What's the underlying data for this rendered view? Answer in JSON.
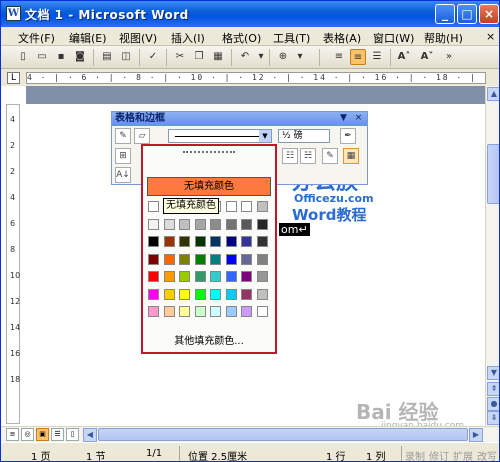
{
  "window": {
    "title": "文档 1 - Microsoft Word"
  },
  "menu": [
    "文件(F)",
    "编辑(E)",
    "视图(V)",
    "插入(I)",
    "格式(O)",
    "工具(T)",
    "表格(A)",
    "窗口(W)",
    "帮助(H)"
  ],
  "ruler": {
    "text": "4 · | · 6 · | · 8 · | · 10 · | · 12 · | · 14 · | · 16 · | · 18 · | · 20 · | · 22 · | · 24 · | · 26 · | · 28 · | · 30 · | · 32 · | · 34 · | · 36 · | · 38"
  },
  "vruler": [
    "4",
    "2",
    "2",
    "4",
    "6",
    "8",
    "10",
    "12",
    "14",
    "16",
    "18"
  ],
  "tables_toolbar": {
    "title": "表格和边框",
    "line_weight": "½ 磅",
    "close": "×",
    "menu": "▼"
  },
  "fill_panel": {
    "no_fill_button": "无填充颜色",
    "tooltip": "无填充颜色",
    "more_fill": "其他填充颜色...",
    "swatch_colors": [
      [
        "#ffffff",
        "#ffffff",
        "#ffffff",
        "#ffffff",
        "#ffffff",
        "#ffffff",
        "#ffffff",
        "#c0c0c0"
      ],
      [
        "#f2f2f2",
        "#dcdcdc",
        "#bfbfbf",
        "#a6a6a6",
        "#8c8c8c",
        "#737373",
        "#595959",
        "#262626"
      ],
      [
        "#000000",
        "#993300",
        "#333300",
        "#003300",
        "#003366",
        "#000080",
        "#333399",
        "#333333"
      ],
      [
        "#800000",
        "#ff6600",
        "#808000",
        "#008000",
        "#008080",
        "#0000ff",
        "#666699",
        "#808080"
      ],
      [
        "#ff0000",
        "#ff9900",
        "#99cc00",
        "#339966",
        "#33cccc",
        "#3366ff",
        "#800080",
        "#969696"
      ],
      [
        "#ff00ff",
        "#ffcc00",
        "#ffff00",
        "#00ff00",
        "#00ffff",
        "#00ccff",
        "#993366",
        "#c0c0c0"
      ],
      [
        "#ff99cc",
        "#ffcc99",
        "#ffff99",
        "#ccffcc",
        "#ccffff",
        "#99ccff",
        "#cc99ff",
        "#ffffff"
      ]
    ]
  },
  "document": {
    "visible_text": "om↵"
  },
  "watermark": {
    "line1": "办公族",
    "line2": "Officezu.com",
    "line3": "Word教程",
    "baidu": "Bai 经验",
    "baidu_url": "jingyan.baidu.com"
  },
  "status": {
    "page": "1 页",
    "section": "1 节",
    "pages": "1/1",
    "position": "位置 2.5厘米",
    "line": "1 行",
    "column": "1 列",
    "rec": "录制",
    "trk": "修订",
    "ext": "扩展",
    "ovr": "改写"
  }
}
